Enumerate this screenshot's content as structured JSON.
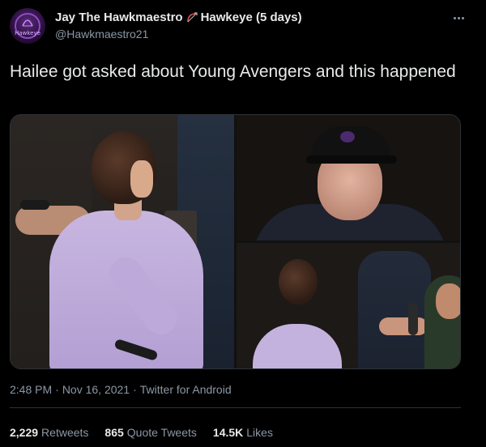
{
  "author": {
    "display_name": "Jay The Hawkmaestro",
    "display_name_suffix": "Hawkeye (5 days)",
    "handle": "@Hawkmaestro21",
    "avatar_text": "Hawkeye"
  },
  "tweet": {
    "text": "Hailee got asked about Young Avengers and this happened"
  },
  "meta": {
    "time": "2:48 PM",
    "sep1": "·",
    "date": "Nov 16, 2021",
    "sep2": "·",
    "source": "Twitter for Android"
  },
  "stats": {
    "retweets_count": "2,229",
    "retweets_label": "Retweets",
    "quotes_count": "865",
    "quotes_label": "Quote Tweets",
    "likes_count": "14.5K",
    "likes_label": "Likes"
  },
  "colors": {
    "background": "#000000",
    "text_primary": "#e7e9ea",
    "text_secondary": "#8b98a5",
    "divider": "#2f3336",
    "hawkeye_purple": "#8e4cc4"
  },
  "icons": {
    "more": "more-horizontal-icon",
    "bow": "bow-and-arrow-icon"
  }
}
